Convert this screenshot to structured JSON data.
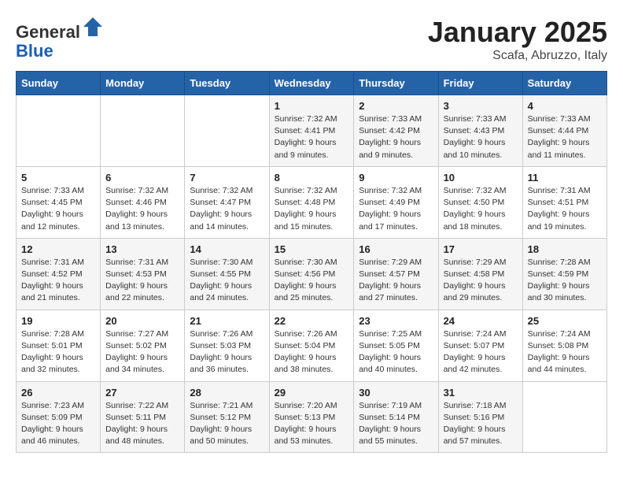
{
  "header": {
    "logo_line1": "General",
    "logo_line2": "Blue",
    "month": "January 2025",
    "location": "Scafa, Abruzzo, Italy"
  },
  "days_of_week": [
    "Sunday",
    "Monday",
    "Tuesday",
    "Wednesday",
    "Thursday",
    "Friday",
    "Saturday"
  ],
  "weeks": [
    [
      {
        "day": "",
        "info": ""
      },
      {
        "day": "",
        "info": ""
      },
      {
        "day": "",
        "info": ""
      },
      {
        "day": "1",
        "info": "Sunrise: 7:32 AM\nSunset: 4:41 PM\nDaylight: 9 hours\nand 9 minutes."
      },
      {
        "day": "2",
        "info": "Sunrise: 7:33 AM\nSunset: 4:42 PM\nDaylight: 9 hours\nand 9 minutes."
      },
      {
        "day": "3",
        "info": "Sunrise: 7:33 AM\nSunset: 4:43 PM\nDaylight: 9 hours\nand 10 minutes."
      },
      {
        "day": "4",
        "info": "Sunrise: 7:33 AM\nSunset: 4:44 PM\nDaylight: 9 hours\nand 11 minutes."
      }
    ],
    [
      {
        "day": "5",
        "info": "Sunrise: 7:33 AM\nSunset: 4:45 PM\nDaylight: 9 hours\nand 12 minutes."
      },
      {
        "day": "6",
        "info": "Sunrise: 7:32 AM\nSunset: 4:46 PM\nDaylight: 9 hours\nand 13 minutes."
      },
      {
        "day": "7",
        "info": "Sunrise: 7:32 AM\nSunset: 4:47 PM\nDaylight: 9 hours\nand 14 minutes."
      },
      {
        "day": "8",
        "info": "Sunrise: 7:32 AM\nSunset: 4:48 PM\nDaylight: 9 hours\nand 15 minutes."
      },
      {
        "day": "9",
        "info": "Sunrise: 7:32 AM\nSunset: 4:49 PM\nDaylight: 9 hours\nand 17 minutes."
      },
      {
        "day": "10",
        "info": "Sunrise: 7:32 AM\nSunset: 4:50 PM\nDaylight: 9 hours\nand 18 minutes."
      },
      {
        "day": "11",
        "info": "Sunrise: 7:31 AM\nSunset: 4:51 PM\nDaylight: 9 hours\nand 19 minutes."
      }
    ],
    [
      {
        "day": "12",
        "info": "Sunrise: 7:31 AM\nSunset: 4:52 PM\nDaylight: 9 hours\nand 21 minutes."
      },
      {
        "day": "13",
        "info": "Sunrise: 7:31 AM\nSunset: 4:53 PM\nDaylight: 9 hours\nand 22 minutes."
      },
      {
        "day": "14",
        "info": "Sunrise: 7:30 AM\nSunset: 4:55 PM\nDaylight: 9 hours\nand 24 minutes."
      },
      {
        "day": "15",
        "info": "Sunrise: 7:30 AM\nSunset: 4:56 PM\nDaylight: 9 hours\nand 25 minutes."
      },
      {
        "day": "16",
        "info": "Sunrise: 7:29 AM\nSunset: 4:57 PM\nDaylight: 9 hours\nand 27 minutes."
      },
      {
        "day": "17",
        "info": "Sunrise: 7:29 AM\nSunset: 4:58 PM\nDaylight: 9 hours\nand 29 minutes."
      },
      {
        "day": "18",
        "info": "Sunrise: 7:28 AM\nSunset: 4:59 PM\nDaylight: 9 hours\nand 30 minutes."
      }
    ],
    [
      {
        "day": "19",
        "info": "Sunrise: 7:28 AM\nSunset: 5:01 PM\nDaylight: 9 hours\nand 32 minutes."
      },
      {
        "day": "20",
        "info": "Sunrise: 7:27 AM\nSunset: 5:02 PM\nDaylight: 9 hours\nand 34 minutes."
      },
      {
        "day": "21",
        "info": "Sunrise: 7:26 AM\nSunset: 5:03 PM\nDaylight: 9 hours\nand 36 minutes."
      },
      {
        "day": "22",
        "info": "Sunrise: 7:26 AM\nSunset: 5:04 PM\nDaylight: 9 hours\nand 38 minutes."
      },
      {
        "day": "23",
        "info": "Sunrise: 7:25 AM\nSunset: 5:05 PM\nDaylight: 9 hours\nand 40 minutes."
      },
      {
        "day": "24",
        "info": "Sunrise: 7:24 AM\nSunset: 5:07 PM\nDaylight: 9 hours\nand 42 minutes."
      },
      {
        "day": "25",
        "info": "Sunrise: 7:24 AM\nSunset: 5:08 PM\nDaylight: 9 hours\nand 44 minutes."
      }
    ],
    [
      {
        "day": "26",
        "info": "Sunrise: 7:23 AM\nSunset: 5:09 PM\nDaylight: 9 hours\nand 46 minutes."
      },
      {
        "day": "27",
        "info": "Sunrise: 7:22 AM\nSunset: 5:11 PM\nDaylight: 9 hours\nand 48 minutes."
      },
      {
        "day": "28",
        "info": "Sunrise: 7:21 AM\nSunset: 5:12 PM\nDaylight: 9 hours\nand 50 minutes."
      },
      {
        "day": "29",
        "info": "Sunrise: 7:20 AM\nSunset: 5:13 PM\nDaylight: 9 hours\nand 53 minutes."
      },
      {
        "day": "30",
        "info": "Sunrise: 7:19 AM\nSunset: 5:14 PM\nDaylight: 9 hours\nand 55 minutes."
      },
      {
        "day": "31",
        "info": "Sunrise: 7:18 AM\nSunset: 5:16 PM\nDaylight: 9 hours\nand 57 minutes."
      },
      {
        "day": "",
        "info": ""
      }
    ]
  ]
}
